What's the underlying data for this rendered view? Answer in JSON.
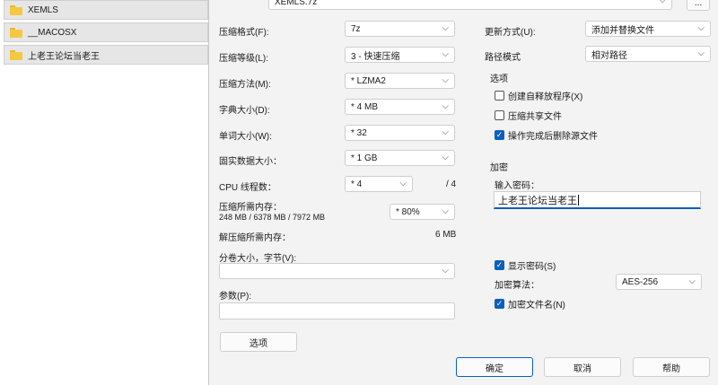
{
  "file_list": [
    {
      "name": "XEMLS"
    },
    {
      "name": "__MACOSX"
    },
    {
      "name": "上老王论坛当老王"
    }
  ],
  "archive_path": "XEMLS.7z",
  "browse_label": "...",
  "left": {
    "format": {
      "label": "压缩格式(F):",
      "value": "7z"
    },
    "level": {
      "label": "压缩等级(L):",
      "value": "3 - 快速压缩"
    },
    "method": {
      "label": "压缩方法(M):",
      "value": "* LZMA2"
    },
    "dict": {
      "label": "字典大小(D):",
      "value": "* 4 MB"
    },
    "word": {
      "label": "单词大小(W):",
      "value": "* 32"
    },
    "solid": {
      "label": "固实数据大小：",
      "value": "* 1 GB"
    },
    "cpu": {
      "label": "CPU 线程数：",
      "value": "* 4",
      "max": "/ 4"
    },
    "mem_compress": {
      "label": "压缩所需内存：",
      "detail": "248 MB / 6378 MB / 7972 MB",
      "value": "* 80%"
    },
    "mem_decompress": {
      "label": "解压缩所需内存：",
      "value": "6 MB"
    },
    "volume": {
      "label": "分卷大小，字节(V):",
      "value": ""
    },
    "params": {
      "label": "参数(P):",
      "value": ""
    },
    "options_button": "选项"
  },
  "right": {
    "update": {
      "label": "更新方式(U):",
      "value": "添加并替换文件"
    },
    "path_mode": {
      "label": "路径模式",
      "value": "相对路径"
    },
    "options_group": {
      "title": "选项",
      "sfx": "创建自释放程序(X)",
      "shared": "压缩共享文件",
      "delete_after": "操作完成后删除源文件"
    },
    "encrypt_group": {
      "title": "加密",
      "password_label": "输入密码：",
      "password_value": "上老王论坛当老王",
      "show_password": "显示密码(S)",
      "method_label": "加密算法：",
      "method_value": "AES-256",
      "encrypt_names": "加密文件名(N)"
    }
  },
  "buttons": {
    "ok": "确定",
    "cancel": "取消",
    "help": "帮助"
  }
}
